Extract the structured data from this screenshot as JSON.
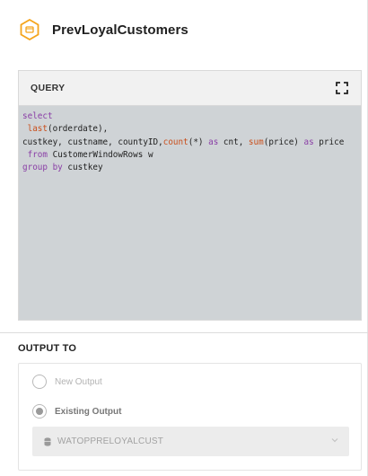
{
  "header": {
    "title": "PrevLoyalCustomers",
    "icon": "hexagon-window-icon",
    "accent_color": "#f5a41a"
  },
  "query": {
    "label": "QUERY",
    "expand_icon": "fullscreen-icon",
    "lines": [
      {
        "parts": [
          {
            "t": "select",
            "c": "kw"
          }
        ]
      },
      {
        "parts": [
          {
            "t": " "
          },
          {
            "t": "last",
            "c": "fn"
          },
          {
            "t": "(orderdate),"
          }
        ]
      },
      {
        "parts": [
          {
            "t": "custkey, custname, countyID,"
          },
          {
            "t": "count",
            "c": "fn"
          },
          {
            "t": "(*) "
          },
          {
            "t": "as",
            "c": "kw"
          },
          {
            "t": " cnt, "
          },
          {
            "t": "sum",
            "c": "fn"
          },
          {
            "t": "(price) "
          },
          {
            "t": "as",
            "c": "kw"
          },
          {
            "t": " price"
          }
        ]
      },
      {
        "parts": [
          {
            "t": " "
          },
          {
            "t": "from",
            "c": "kw"
          },
          {
            "t": " CustomerWindowRows w"
          }
        ]
      },
      {
        "parts": [
          {
            "t": "group by",
            "c": "kw"
          },
          {
            "t": " custkey"
          }
        ]
      }
    ],
    "colors": {
      "keyword": "#8a3ea6",
      "function": "#c94f1c",
      "background": "#cfd3d6"
    }
  },
  "output": {
    "label": "OUTPUT TO",
    "options": [
      {
        "label": "New Output",
        "selected": false
      },
      {
        "label": "Existing Output",
        "selected": true
      }
    ],
    "select": {
      "value": "WATOPPRELOYALCUST",
      "icon": "database-icon",
      "chevron_icon": "chevron-down-icon"
    }
  }
}
